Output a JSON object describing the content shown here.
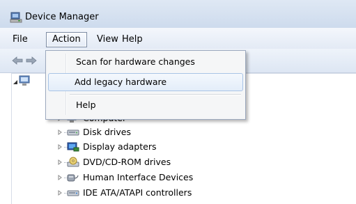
{
  "window": {
    "title": "Device Manager"
  },
  "menubar": {
    "file": "File",
    "action": "Action",
    "view": "View",
    "help": "Help"
  },
  "action_menu": {
    "items": [
      {
        "label": "Scan for hardware changes"
      },
      {
        "label": "Add legacy hardware",
        "highlighted": true
      },
      {
        "label": "Help"
      }
    ]
  },
  "tree": {
    "nodes": [
      {
        "label": "Computer",
        "icon": "computer-icon"
      },
      {
        "label": "Disk drives",
        "icon": "disk-drive-icon"
      },
      {
        "label": "Display adapters",
        "icon": "display-adapter-icon"
      },
      {
        "label": "DVD/CD-ROM drives",
        "icon": "dvd-drive-icon"
      },
      {
        "label": "Human Interface Devices",
        "icon": "hid-icon"
      },
      {
        "label": "IDE ATA/ATAPI controllers",
        "icon": "ide-controller-icon"
      }
    ]
  },
  "colors": {
    "titlebar": "#dfe8f4",
    "menu_highlight_border": "#a8c4e6",
    "menu_background": "#f5f6f7"
  }
}
